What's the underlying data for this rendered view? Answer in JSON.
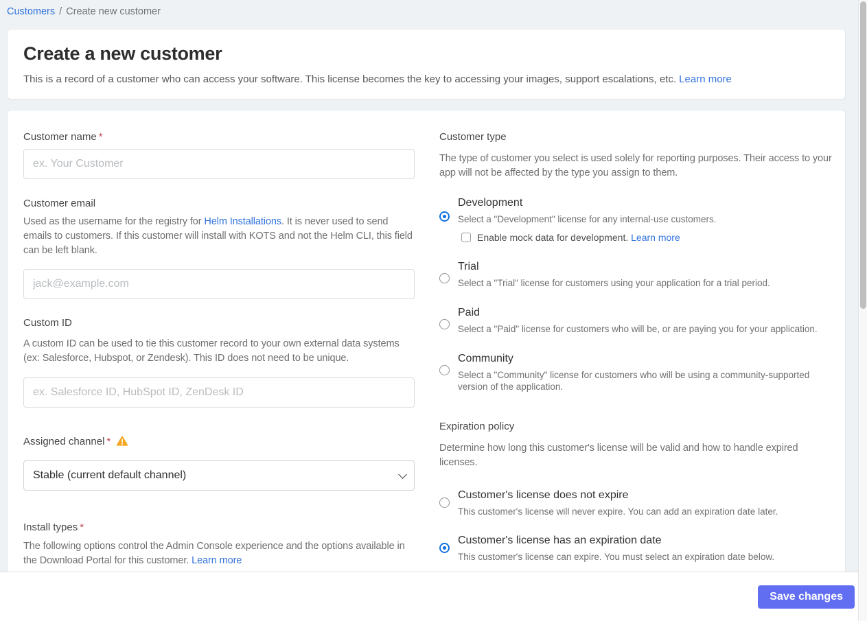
{
  "breadcrumb": {
    "link": "Customers",
    "separator": "/",
    "current": "Create new customer"
  },
  "header": {
    "title": "Create a new customer",
    "description": "This is a record of a customer who can access your software. This license becomes the key to accessing your images, support escalations, etc.",
    "learn_more": "Learn more"
  },
  "form": {
    "customer_name": {
      "label": "Customer name",
      "required_mark": "*",
      "placeholder": "ex. Your Customer",
      "value": ""
    },
    "customer_email": {
      "label": "Customer email",
      "desc_before_link": "Used as the username for the registry for ",
      "desc_link": "Helm Installations",
      "desc_after_link": ". It is never used to send emails to customers. If this customer will install with KOTS and not the Helm CLI, this field can be left blank.",
      "placeholder": "jack@example.com",
      "value": ""
    },
    "custom_id": {
      "label": "Custom ID",
      "description": "A custom ID can be used to tie this customer record to your own external data systems (ex: Salesforce, Hubspot, or Zendesk). This ID does not need to be unique.",
      "placeholder": "ex. Salesforce ID, HubSpot ID, ZenDesk ID",
      "value": ""
    },
    "assigned_channel": {
      "label": "Assigned channel",
      "required_mark": "*",
      "selected_option": "Stable (current default channel)",
      "warning_icon": "warning-triangle"
    },
    "install_types": {
      "label": "Install types",
      "required_mark": "*",
      "description": "The following options control the Admin Console experience and the options available in the Download Portal for this customer.",
      "learn_more": "Learn more"
    }
  },
  "customer_type": {
    "label": "Customer type",
    "description": "The type of customer you select is used solely for reporting purposes. Their access to your app will not be affected by the type you assign to them.",
    "options": [
      {
        "title": "Development",
        "description": "Select a \"Development\" license for any internal-use customers.",
        "selected": true
      },
      {
        "title": "Trial",
        "description": "Select a \"Trial\" license for customers using your application for a trial period.",
        "selected": false
      },
      {
        "title": "Paid",
        "description": "Select a \"Paid\" license for customers who will be, or are paying you for your application.",
        "selected": false
      },
      {
        "title": "Community",
        "description": "Select a \"Community\" license for customers who will be using a community-supported version of the application.",
        "selected": false
      }
    ],
    "mock_data": {
      "label": "Enable mock data for development.",
      "learn_more": "Learn more",
      "checked": false
    }
  },
  "expiration_policy": {
    "label": "Expiration policy",
    "description": "Determine how long this customer's license will be valid and how to handle expired licenses.",
    "options": [
      {
        "title": "Customer's license does not expire",
        "description": "This customer's license will never expire. You can add an expiration date later.",
        "selected": false
      },
      {
        "title": "Customer's license has an expiration date",
        "description": "This customer's license can expire. You must select an expiration date below.",
        "selected": true
      }
    ]
  },
  "footer": {
    "save_label": "Save changes"
  },
  "colors": {
    "page_background": "#eef2f5",
    "link_blue": "#3273dc",
    "required_red": "#bc4752",
    "warning_orange": "#f5a623",
    "radio_selected_blue": "#0f6fde",
    "save_button": "#626ef2"
  }
}
